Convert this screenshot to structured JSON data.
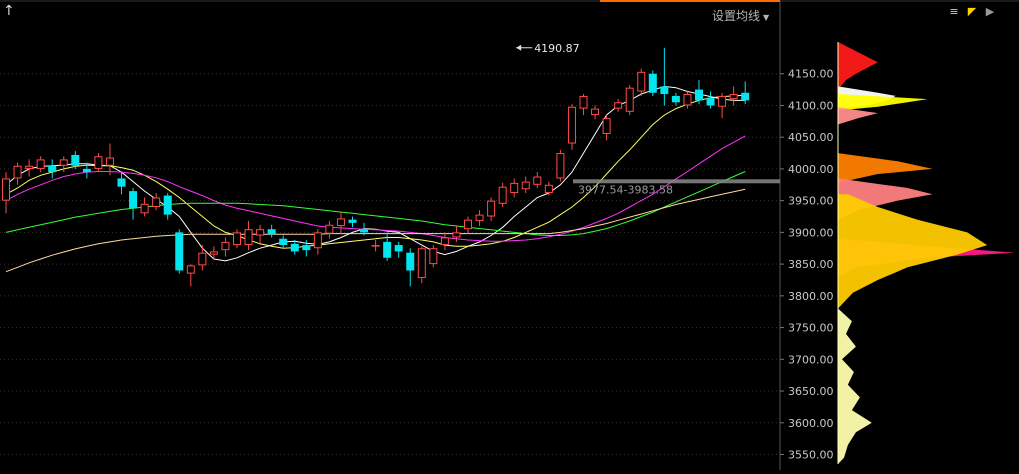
{
  "toolbar": {
    "ma_setting_label": "设置均线",
    "dropdown_icon": "caret-down-icon",
    "back_icon": "up-arrow-icon",
    "tool_icons": [
      "list-icon",
      "pen-icon",
      "play-icon"
    ]
  },
  "colors": {
    "background": "#000000",
    "up": "#ff4a4a",
    "down": "#00e5ee",
    "ma5": "#ffffff",
    "ma10": "#ffff66",
    "ma20": "#ff33ff",
    "ma60": "#33ff33",
    "ma120": "#ffd9a0",
    "axis_text": "#c8c8c8",
    "grid": "#333333"
  },
  "chart_data": {
    "type": "candlestick",
    "y_range": [
      3535,
      4200
    ],
    "y_ticks": [
      "4150.00",
      "4100.00",
      "4050.00",
      "4000.00",
      "3950.00",
      "3900.00",
      "3850.00",
      "3800.00",
      "3750.00",
      "3700.00",
      "3650.00",
      "3600.00",
      "3550.00"
    ],
    "max_annotation": {
      "label": "4190.87",
      "value": 4190.87,
      "index": 44
    },
    "range_annotation": {
      "label": "3977.54-3983.58",
      "value": 3980.5
    },
    "candles": [
      [
        3950,
        3985,
        3930,
        3995
      ],
      [
        3985,
        4005,
        3975,
        4010
      ],
      [
        4000,
        4005,
        3988,
        4015
      ],
      [
        4000,
        4015,
        3995,
        4020
      ],
      [
        4005,
        3995,
        3985,
        4015
      ],
      [
        4005,
        4015,
        3995,
        4020
      ],
      [
        4022,
        4005,
        4000,
        4028
      ],
      [
        4000,
        3995,
        3985,
        4010
      ],
      [
        4000,
        4020,
        3995,
        4025
      ],
      [
        4005,
        4018,
        3990,
        4040
      ],
      [
        3985,
        3972,
        3960,
        3995
      ],
      [
        3965,
        3938,
        3920,
        3970
      ],
      [
        3930,
        3945,
        3925,
        3955
      ],
      [
        3940,
        3955,
        3935,
        3962
      ],
      [
        3958,
        3928,
        3920,
        3962
      ],
      [
        3900,
        3840,
        3835,
        3905
      ],
      [
        3835,
        3848,
        3815,
        3850
      ],
      [
        3848,
        3868,
        3840,
        3880
      ],
      [
        3865,
        3870,
        3858,
        3878
      ],
      [
        3872,
        3885,
        3862,
        3892
      ],
      [
        3880,
        3900,
        3875,
        3905
      ],
      [
        3880,
        3905,
        3872,
        3918
      ],
      [
        3895,
        3905,
        3880,
        3912
      ],
      [
        3905,
        3897,
        3892,
        3912
      ],
      [
        3890,
        3880,
        3875,
        3895
      ],
      [
        3882,
        3870,
        3865,
        3888
      ],
      [
        3880,
        3872,
        3862,
        3888
      ],
      [
        3875,
        3900,
        3865,
        3905
      ],
      [
        3898,
        3912,
        3890,
        3918
      ],
      [
        3910,
        3922,
        3898,
        3932
      ],
      [
        3920,
        3915,
        3908,
        3925
      ],
      [
        3905,
        3900,
        3895,
        3915
      ],
      [
        3878,
        3880,
        3870,
        3888
      ],
      [
        3885,
        3860,
        3855,
        3900
      ],
      [
        3880,
        3870,
        3860,
        3885
      ],
      [
        3868,
        3840,
        3815,
        3875
      ],
      [
        3828,
        3875,
        3820,
        3878
      ],
      [
        3850,
        3875,
        3845,
        3880
      ],
      [
        3880,
        3892,
        3872,
        3900
      ],
      [
        3892,
        3900,
        3885,
        3910
      ],
      [
        3905,
        3920,
        3898,
        3925
      ],
      [
        3918,
        3928,
        3910,
        3935
      ],
      [
        3925,
        3950,
        3918,
        3955
      ],
      [
        3945,
        3972,
        3940,
        3978
      ],
      [
        3962,
        3978,
        3955,
        3985
      ],
      [
        3968,
        3980,
        3962,
        3988
      ],
      [
        3975,
        3988,
        3970,
        3995
      ],
      [
        3962,
        3975,
        3958,
        3980
      ],
      [
        3985,
        4025,
        3980,
        4030
      ],
      [
        4040,
        4098,
        4030,
        4102
      ],
      [
        4095,
        4115,
        4085,
        4118
      ],
      [
        4085,
        4095,
        4078,
        4100
      ],
      [
        4055,
        4080,
        4045,
        4085
      ],
      [
        4095,
        4105,
        4090,
        4110
      ],
      [
        4090,
        4128,
        4085,
        4132
      ],
      [
        4122,
        4153,
        4115,
        4158
      ],
      [
        4150,
        4120,
        4115,
        4155
      ],
      [
        4130,
        4118,
        4100,
        4190.87
      ],
      [
        4115,
        4105,
        4100,
        4120
      ],
      [
        4100,
        4118,
        4095,
        4122
      ],
      [
        4125,
        4108,
        4102,
        4140
      ],
      [
        4112,
        4100,
        4095,
        4122
      ],
      [
        4098,
        4115,
        4080,
        4120
      ],
      [
        4110,
        4118,
        4100,
        4130
      ],
      [
        4120,
        4108,
        4102,
        4138
      ]
    ],
    "moving_averages": [
      {
        "name": "MA5",
        "color": "#ffffff",
        "values": [
          3975,
          3990,
          4000,
          4004,
          4005,
          4006,
          4008,
          4008,
          4006,
          4005,
          3995,
          3980,
          3965,
          3952,
          3940,
          3925,
          3900,
          3875,
          3858,
          3855,
          3860,
          3868,
          3875,
          3880,
          3885,
          3886,
          3883,
          3881,
          3885,
          3892,
          3900,
          3906,
          3905,
          3902,
          3900,
          3890,
          3880,
          3870,
          3865,
          3870,
          3878,
          3885,
          3895,
          3908,
          3925,
          3940,
          3955,
          3962,
          3975,
          3995,
          4025,
          4055,
          4085,
          4100,
          4108,
          4118,
          4124,
          4130,
          4128,
          4122,
          4118,
          4114,
          4110,
          4108,
          4108
        ]
      },
      {
        "name": "MA10",
        "color": "#ffff66",
        "values": [
          3960,
          3970,
          3982,
          3990,
          3995,
          4000,
          4004,
          4006,
          4005,
          4005,
          4002,
          3998,
          3990,
          3980,
          3968,
          3955,
          3940,
          3925,
          3910,
          3900,
          3895,
          3888,
          3882,
          3878,
          3875,
          3876,
          3878,
          3880,
          3882,
          3884,
          3886,
          3888,
          3890,
          3892,
          3892,
          3890,
          3888,
          3885,
          3880,
          3878,
          3878,
          3880,
          3882,
          3886,
          3892,
          3900,
          3908,
          3916,
          3928,
          3940,
          3955,
          3972,
          3992,
          4012,
          4030,
          4050,
          4070,
          4085,
          4095,
          4102,
          4108,
          4112,
          4114,
          4115,
          4116
        ]
      },
      {
        "name": "MA20",
        "color": "#ff33ff",
        "values": [
          3950,
          3960,
          3968,
          3975,
          3982,
          3988,
          3992,
          3995,
          3996,
          3996,
          3995,
          3993,
          3990,
          3986,
          3980,
          3972,
          3965,
          3958,
          3950,
          3943,
          3938,
          3934,
          3930,
          3926,
          3922,
          3918,
          3914,
          3910,
          3908,
          3907,
          3906,
          3905,
          3904,
          3903,
          3902,
          3900,
          3898,
          3895,
          3892,
          3890,
          3888,
          3887,
          3886,
          3886,
          3887,
          3888,
          3890,
          3893,
          3897,
          3902,
          3908,
          3915,
          3922,
          3930,
          3940,
          3950,
          3960,
          3972,
          3984,
          3996,
          4008,
          4020,
          4032,
          4042,
          4052
        ]
      },
      {
        "name": "MA60",
        "color": "#33ff33",
        "values": [
          3900,
          3904,
          3908,
          3912,
          3916,
          3920,
          3924,
          3927,
          3930,
          3933,
          3936,
          3938,
          3940,
          3942,
          3944,
          3945,
          3946,
          3946,
          3946,
          3946,
          3946,
          3945,
          3944,
          3943,
          3942,
          3940,
          3938,
          3936,
          3934,
          3932,
          3930,
          3928,
          3926,
          3924,
          3922,
          3920,
          3918,
          3915,
          3912,
          3910,
          3908,
          3906,
          3904,
          3902,
          3900,
          3898,
          3896,
          3895,
          3895,
          3896,
          3898,
          3902,
          3906,
          3912,
          3918,
          3925,
          3932,
          3940,
          3948,
          3956,
          3964,
          3972,
          3980,
          3988,
          3996
        ]
      },
      {
        "name": "MA120",
        "color": "#ffd9a0",
        "values": [
          3838,
          3845,
          3852,
          3858,
          3864,
          3869,
          3874,
          3878,
          3882,
          3885,
          3888,
          3890,
          3892,
          3894,
          3895,
          3896,
          3897,
          3897,
          3897,
          3897,
          3897,
          3897,
          3897,
          3897,
          3897,
          3897,
          3897,
          3897,
          3898,
          3898,
          3898,
          3898,
          3898,
          3898,
          3898,
          3898,
          3898,
          3898,
          3898,
          3898,
          3898,
          3898,
          3898,
          3898,
          3898,
          3898,
          3898,
          3898,
          3900,
          3903,
          3906,
          3910,
          3914,
          3919,
          3924,
          3929,
          3934,
          3939,
          3944,
          3948,
          3952,
          3956,
          3960,
          3964,
          3968
        ]
      }
    ],
    "volume_profile": [
      {
        "name": "profile-red",
        "color": "#ff1a1a",
        "peaks": [
          [
            4200,
            0
          ],
          [
            4168,
            40
          ],
          [
            4150,
            18
          ],
          [
            4140,
            8
          ],
          [
            4125,
            0
          ]
        ]
      },
      {
        "name": "profile-white",
        "color": "#ffffff",
        "peaks": [
          [
            4130,
            0
          ],
          [
            4120,
            40
          ],
          [
            4115,
            58
          ],
          [
            4108,
            50
          ],
          [
            4100,
            30
          ],
          [
            4095,
            0
          ]
        ]
      },
      {
        "name": "profile-yellow",
        "color": "#ffff00",
        "peaks": [
          [
            4118,
            0
          ],
          [
            4110,
            90
          ],
          [
            4105,
            70
          ],
          [
            4098,
            40
          ],
          [
            4092,
            0
          ]
        ]
      },
      {
        "name": "profile-pink-top",
        "color": "#ff8c8c",
        "peaks": [
          [
            4097,
            0
          ],
          [
            4088,
            40
          ],
          [
            4080,
            20
          ],
          [
            4070,
            0
          ]
        ]
      },
      {
        "name": "profile-orange",
        "color": "#ff8000",
        "peaks": [
          [
            4025,
            0
          ],
          [
            4012,
            60
          ],
          [
            4000,
            95
          ],
          [
            3992,
            40
          ],
          [
            3978,
            0
          ]
        ]
      },
      {
        "name": "profile-salmon",
        "color": "#ff8080",
        "peaks": [
          [
            3985,
            0
          ],
          [
            3970,
            70
          ],
          [
            3960,
            95
          ],
          [
            3950,
            60
          ],
          [
            3935,
            20
          ],
          [
            3920,
            0
          ]
        ]
      },
      {
        "name": "profile-magenta",
        "color": "#ff1a88",
        "peaks": [
          [
            3890,
            0
          ],
          [
            3875,
            120
          ],
          [
            3868,
            178
          ],
          [
            3860,
            90
          ],
          [
            3845,
            20
          ],
          [
            3830,
            0
          ]
        ]
      },
      {
        "name": "profile-gold",
        "color": "#ffcc00",
        "peaks": [
          [
            3960,
            10
          ],
          [
            3940,
            40
          ],
          [
            3920,
            80
          ],
          [
            3900,
            130
          ],
          [
            3880,
            150
          ],
          [
            3865,
            120
          ],
          [
            3845,
            70
          ],
          [
            3825,
            40
          ],
          [
            3805,
            15
          ],
          [
            3780,
            0
          ]
        ]
      },
      {
        "name": "profile-cream",
        "color": "#ffffb0",
        "peaks": [
          [
            3780,
            0
          ],
          [
            3760,
            14
          ],
          [
            3740,
            8
          ],
          [
            3720,
            18
          ],
          [
            3700,
            4
          ],
          [
            3680,
            16
          ],
          [
            3660,
            10
          ],
          [
            3640,
            22
          ],
          [
            3620,
            14
          ],
          [
            3600,
            34
          ],
          [
            3585,
            18
          ],
          [
            3565,
            10
          ],
          [
            3545,
            6
          ],
          [
            3535,
            0
          ]
        ]
      }
    ]
  }
}
